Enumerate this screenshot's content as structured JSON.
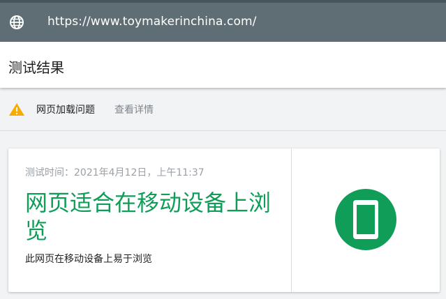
{
  "url_bar": {
    "url": "https://www.toymakerinchina.com/",
    "icon": "globe-icon"
  },
  "header": {
    "title": "测试结果"
  },
  "issues": {
    "icon": "warning-icon",
    "label": "网页加载问题",
    "link": "查看详情",
    "icon_color": "#f9ab00"
  },
  "result_card": {
    "test_time": "测试时间：2021年4月12日，上午11:37",
    "verdict": "网页适合在移动设备上浏览",
    "description": "此网页在移动设备上易于浏览",
    "status_icon": "mobile-phone-icon",
    "accent_color": "#0f9d58"
  }
}
